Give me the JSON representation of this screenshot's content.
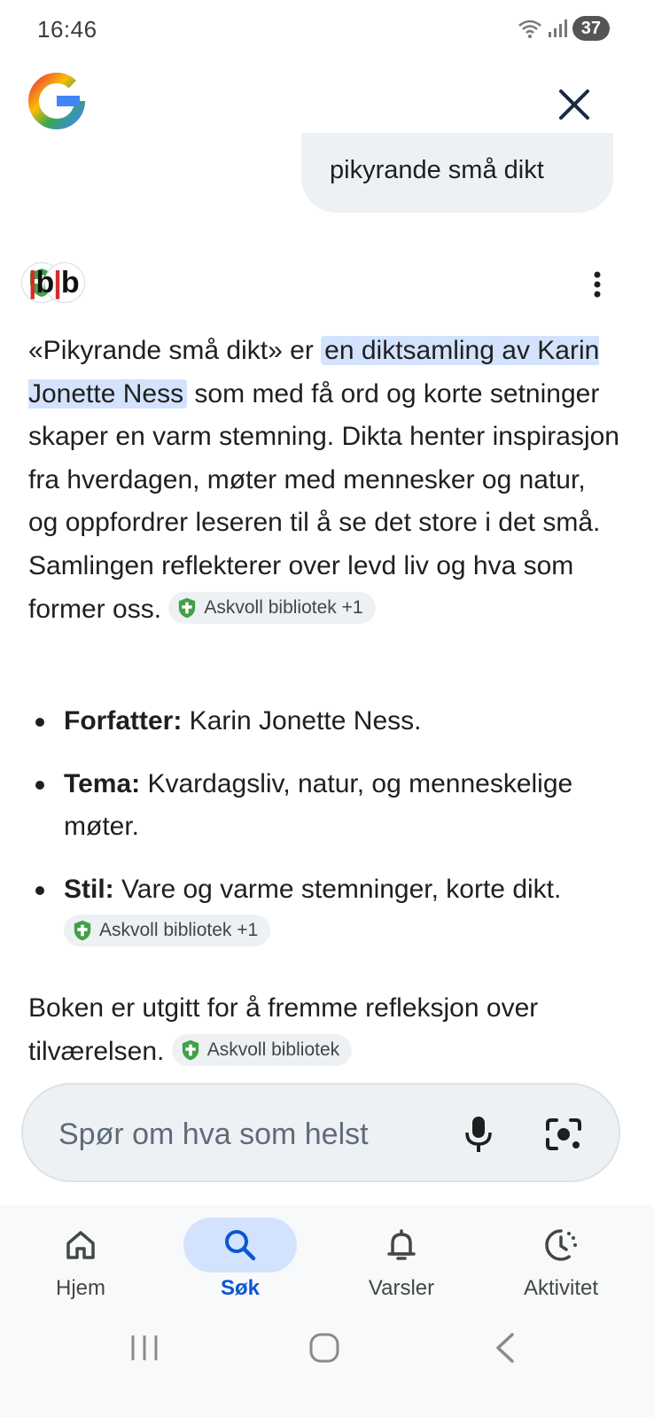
{
  "status_bar": {
    "time": "16:46",
    "battery": "37"
  },
  "header": {
    "logo_icon": "google-g-icon",
    "close_icon": "close-icon"
  },
  "query": {
    "text": "pikyrande små dikt"
  },
  "source": {
    "logo_text_red": "b",
    "logo_text": "lb",
    "menu_icon": "more-vert-icon"
  },
  "answer": {
    "part1": "«Pikyrande små dikt» er ",
    "highlight": "en diktsamling av Karin Jonette Ness",
    "part2": " som med få ord og korte setninger skaper en varm stemning. Dikta henter inspirasjon fra hverdagen, møter med mennesker og natur, og oppfordrer leseren til å se det store i det små. Samlingen reflekterer over levd liv og hva som former oss.",
    "chip": "Askvoll bibliotek +1"
  },
  "facts": [
    {
      "label": "Forfatter:",
      "value": " Karin Jonette Ness."
    },
    {
      "label": "Tema:",
      "value": " Kvardagsliv, natur, og menneskelige møter."
    },
    {
      "label": "Stil:",
      "value": " Vare og varme stemninger, korte dikt.",
      "chip": "Askvoll bibliotek +1"
    }
  ],
  "closing": {
    "text": "Boken er utgitt for å fremme refleksjon over tilværelsen.",
    "chip": "Askvoll bibliotek"
  },
  "search": {
    "placeholder": "Spør om hva som helst"
  },
  "nav": {
    "items": [
      {
        "label": "Hjem",
        "icon": "home-icon"
      },
      {
        "label": "Søk",
        "icon": "search-icon",
        "active": true
      },
      {
        "label": "Varsler",
        "icon": "bell-icon"
      },
      {
        "label": "Aktivitet",
        "icon": "activity-icon"
      }
    ]
  },
  "colors": {
    "accent": "#0b57d0",
    "highlight": "#d3e3fd",
    "chip_bg": "#eef1f4",
    "shield_green": "#4caf50"
  }
}
